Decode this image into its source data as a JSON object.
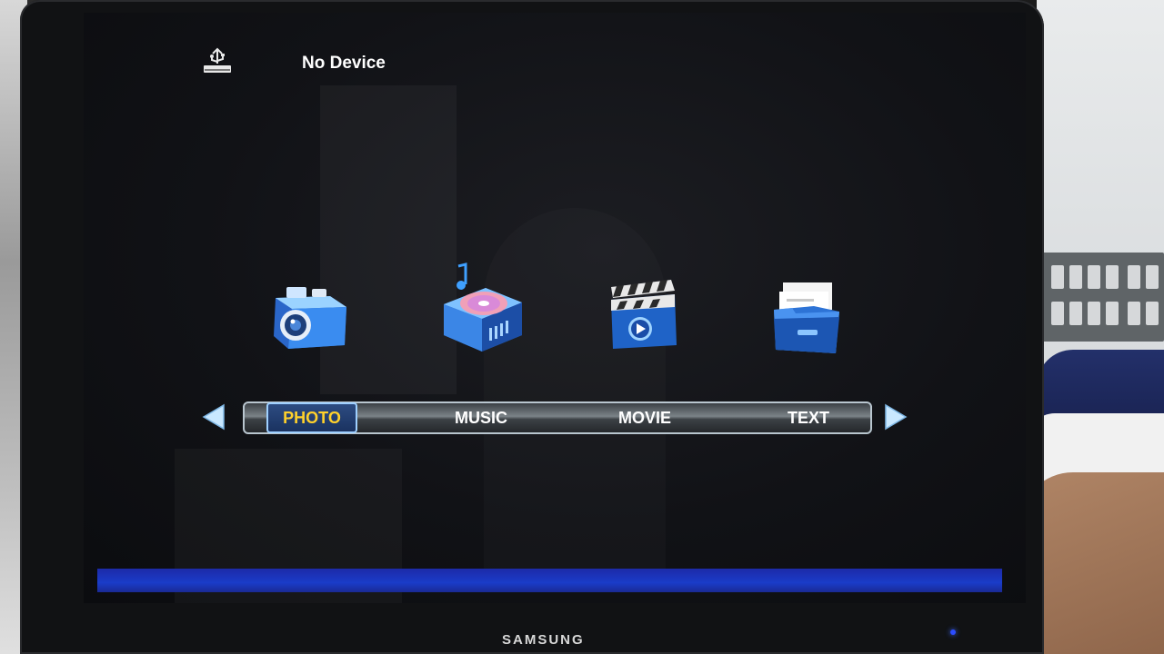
{
  "status": {
    "device_label": "No Device",
    "usb_icon": "usb-drive-icon"
  },
  "menu": {
    "items": [
      {
        "label": "PHOTO",
        "icon": "camera-icon",
        "selected": true
      },
      {
        "label": "MUSIC",
        "icon": "music-player-icon",
        "selected": false
      },
      {
        "label": "MOVIE",
        "icon": "clapperboard-icon",
        "selected": false
      },
      {
        "label": "TEXT",
        "icon": "document-folder-icon",
        "selected": false
      }
    ],
    "nav_left_icon": "arrow-left-icon",
    "nav_right_icon": "arrow-right-icon"
  },
  "monitor": {
    "brand": "SAMSUNG"
  },
  "colors": {
    "selected_text": "#ffd12b",
    "menu_text": "#ffffff",
    "bottom_bar": "#1a3cc9",
    "screen_bg": "#111216"
  }
}
